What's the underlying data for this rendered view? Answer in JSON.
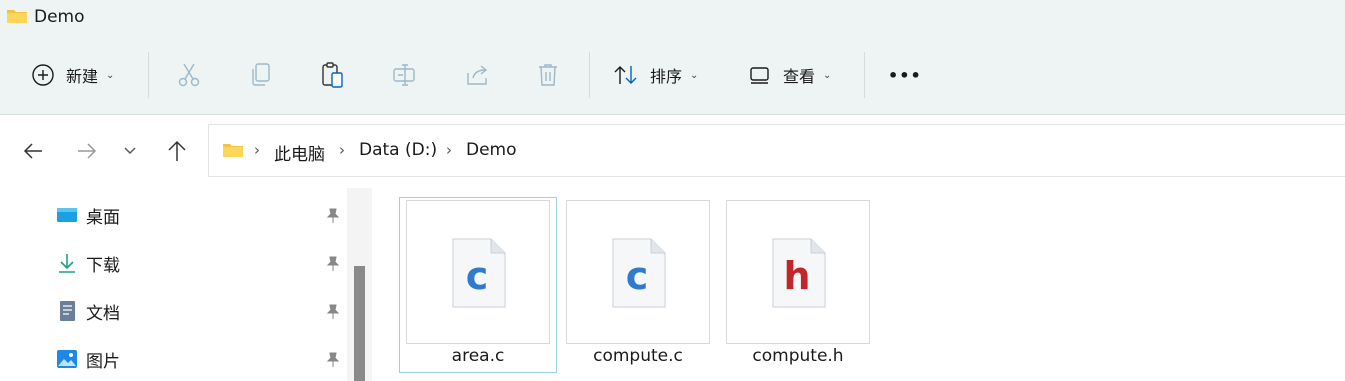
{
  "window": {
    "title": "Demo"
  },
  "toolbar": {
    "new_label": "新建",
    "sort_label": "排序",
    "view_label": "查看",
    "more_label": "•••"
  },
  "breadcrumb": [
    "此电脑",
    "Data (D:)",
    "Demo"
  ],
  "sidebar": {
    "items": [
      {
        "label": "桌面",
        "icon": "desktop-icon"
      },
      {
        "label": "下载",
        "icon": "download-icon"
      },
      {
        "label": "文档",
        "icon": "document-icon"
      },
      {
        "label": "图片",
        "icon": "pictures-icon"
      }
    ]
  },
  "files": [
    {
      "name": "area.c",
      "letter": "c",
      "type": "c-source",
      "color": "#2f7bd1",
      "selected": true
    },
    {
      "name": "compute.c",
      "letter": "c",
      "type": "c-source",
      "color": "#2f7bd1",
      "selected": false
    },
    {
      "name": "compute.h",
      "letter": "h",
      "type": "c-header",
      "color": "#c0262a",
      "selected": false
    }
  ],
  "colors": {
    "accent": "#0067c0",
    "folder": "#f5c342",
    "selection": "#9fd0e6"
  }
}
